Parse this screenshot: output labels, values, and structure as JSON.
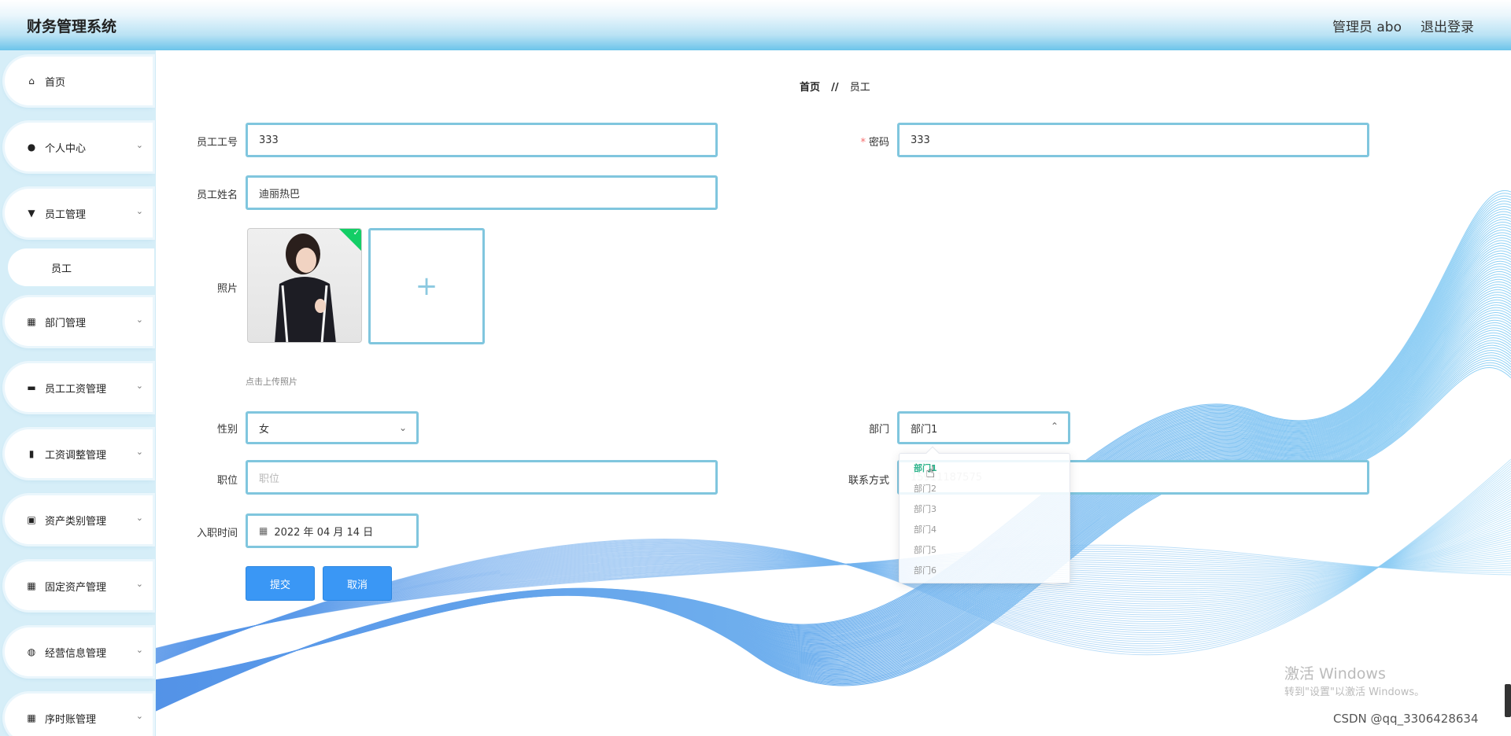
{
  "header": {
    "title": "财务管理系统",
    "user": "管理员 abo",
    "logout": "退出登录"
  },
  "sidebar": {
    "items": [
      {
        "label": "首页",
        "icon": "home-icon",
        "glyph": "⌂"
      },
      {
        "label": "个人中心",
        "icon": "user-icon",
        "glyph": "●"
      },
      {
        "label": "员工管理",
        "icon": "stamp-icon",
        "glyph": "▼"
      },
      {
        "label": "部门管理",
        "icon": "grid-icon",
        "glyph": "▦"
      },
      {
        "label": "员工工资管理",
        "icon": "briefcase-icon",
        "glyph": "▬"
      },
      {
        "label": "工资调整管理",
        "icon": "bar-chart-icon",
        "glyph": "▮"
      },
      {
        "label": "资产类别管理",
        "icon": "clipboard-check-icon",
        "glyph": "▣"
      },
      {
        "label": "固定资产管理",
        "icon": "grid-icon",
        "glyph": "▦"
      },
      {
        "label": "经营信息管理",
        "icon": "lightbulb-icon",
        "glyph": "◍"
      },
      {
        "label": "序时账管理",
        "icon": "table-icon",
        "glyph": "▦"
      }
    ],
    "sub_item": "员工"
  },
  "breadcrumb": {
    "home": "首页",
    "separator": "//",
    "current": "员工"
  },
  "form": {
    "emp_no": {
      "label": "员工工号",
      "value": "333"
    },
    "password": {
      "label": "密码",
      "required_mark": "*",
      "value": "333"
    },
    "emp_name": {
      "label": "员工姓名",
      "value": "迪丽热巴"
    },
    "photo": {
      "label": "照片",
      "tip": "点击上传照片",
      "add": "+"
    },
    "gender": {
      "label": "性别",
      "value": "女"
    },
    "department": {
      "label": "部门",
      "value": "部门1"
    },
    "position": {
      "label": "职位",
      "placeholder": "职位"
    },
    "contact": {
      "label": "联系方式",
      "value": "15911187575"
    },
    "hire_date": {
      "label": "入职时间",
      "value": "2022 年 04 月 14 日"
    },
    "submit": "提交",
    "cancel": "取消"
  },
  "department_options": [
    "部门1",
    "部门2",
    "部门3",
    "部门4",
    "部门5",
    "部门6"
  ],
  "watermark": {
    "windows_title": "激活 Windows",
    "windows_sub": "转到\"设置\"以激活 Windows。",
    "csdn": "CSDN @qq_3306428634"
  },
  "colors": {
    "primary": "#3a97f5",
    "input_border": "#80c6de",
    "sidebar_bg": "#d6eef8",
    "selected_option": "#2db38c"
  }
}
